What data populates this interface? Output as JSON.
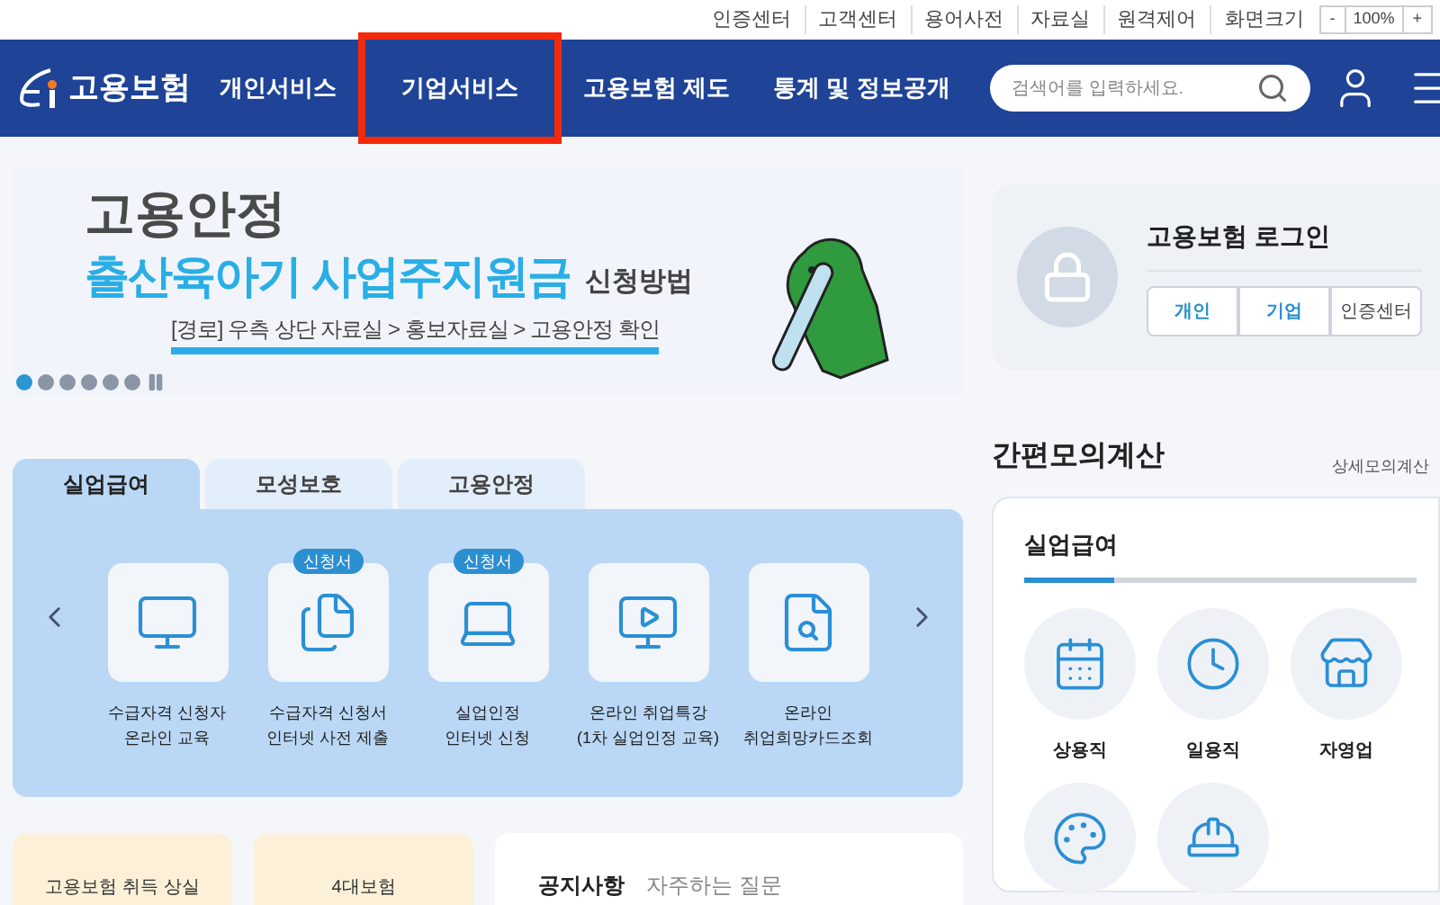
{
  "utility_links": [
    "인증센터",
    "고객센터",
    "용어사전",
    "자료실",
    "원격제어"
  ],
  "zoom": {
    "label": "화면크기",
    "minus": "-",
    "value": "100%",
    "plus": "+"
  },
  "logo": {
    "text": "고용보험"
  },
  "nav": [
    {
      "label": "개인서비스",
      "highlighted": false
    },
    {
      "label": "기업서비스",
      "highlighted": true
    },
    {
      "label": "고용보험 제도",
      "highlighted": false
    },
    {
      "label": "통계 및 정보공개",
      "highlighted": false
    }
  ],
  "search": {
    "placeholder": "검색어를 입력하세요."
  },
  "banner": {
    "line1": "고용안정",
    "line2_highlight": "출산육아기 사업주지원금",
    "line2_rest": "신청방법",
    "path": "[경로] 우측 상단 자료실 > 홍보자료실 > 고용안정 확인",
    "dots": [
      {
        "selected": true
      },
      {
        "selected": false
      },
      {
        "selected": false
      },
      {
        "selected": false
      },
      {
        "selected": false
      },
      {
        "selected": false
      }
    ]
  },
  "login": {
    "title": "고용보험 로그인",
    "buttons": [
      {
        "label": "개인",
        "kind": "primary"
      },
      {
        "label": "기업",
        "kind": "primary"
      },
      {
        "label": "인증센터",
        "kind": "plain"
      }
    ]
  },
  "tabs": [
    {
      "label": "실업급여",
      "selected": true
    },
    {
      "label": "모성보호",
      "selected": false
    },
    {
      "label": "고용안정",
      "selected": false
    }
  ],
  "services": [
    {
      "lines": [
        "수급자격 신청자",
        "온라인 교육"
      ]
    },
    {
      "badge": "신청서",
      "lines": [
        "수급자격 신청서",
        "인터넷 사전 제출"
      ]
    },
    {
      "badge": "신청서",
      "lines": [
        "실업인정",
        "인터넷 신청"
      ]
    },
    {
      "lines": [
        "온라인 취업특강",
        "(1차 실업인정 교육)"
      ]
    },
    {
      "lines": [
        "온라인",
        "취업희망카드조회"
      ]
    }
  ],
  "calculator": {
    "title": "간편모의계산",
    "detail_link": "상세모의계산",
    "card_title": "실업급여",
    "items": [
      {
        "kind": "labeled",
        "label": "상용직"
      },
      {
        "kind": "labeled",
        "label": "일용직"
      },
      {
        "kind": "labeled",
        "label": "자영업"
      },
      {
        "kind": "icon_only"
      },
      {
        "kind": "icon_only"
      }
    ]
  },
  "bottom_cards": [
    {
      "label": "고용보험 취득 상실"
    },
    {
      "label": "4대보험"
    }
  ],
  "notice_tabs": [
    "공지사항",
    "자주하는 질문"
  ]
}
